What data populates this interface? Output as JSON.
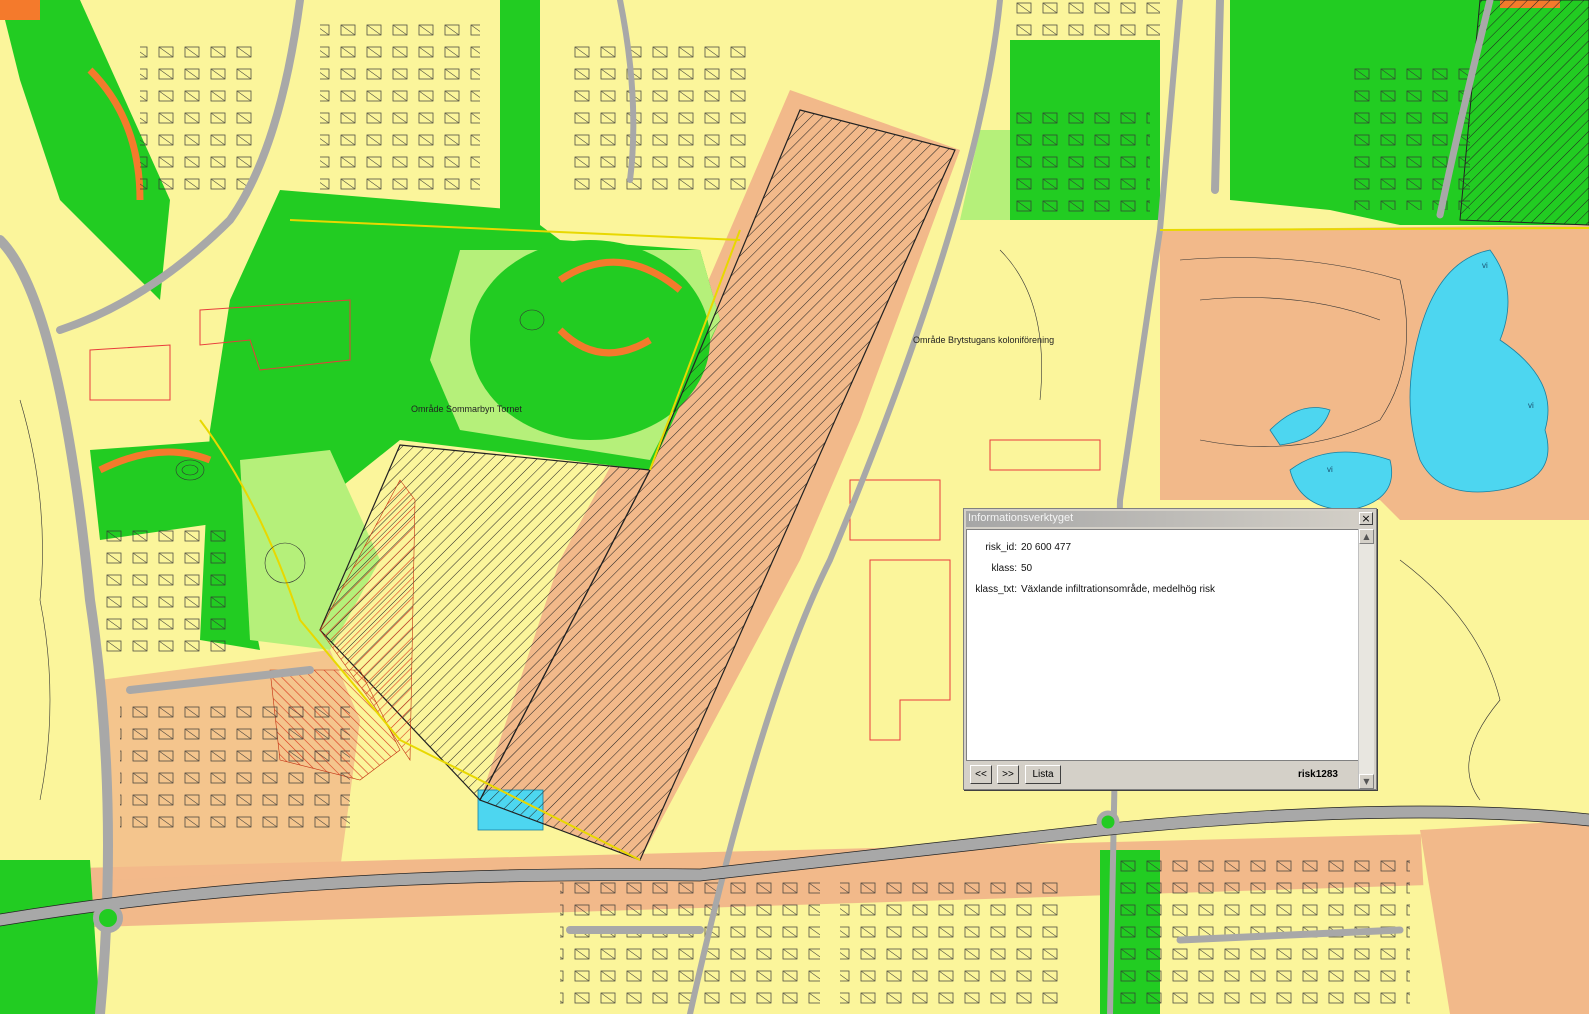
{
  "map": {
    "labels": {
      "sommarbyn": "Område Sommarbyn Tornet",
      "brytstugan": "Område Brytstugans koloniförening"
    },
    "water_labels": [
      "vi",
      "vi",
      "vi"
    ],
    "colors": {
      "base_yellow": "#fbf59b",
      "green": "#22cc22",
      "light_green": "#b5f07a",
      "salmon": "#f2b98a",
      "orange": "#f47a2c",
      "water": "#4dd6f0",
      "road": "#a8a8a8",
      "building_red": "#e83c3c"
    }
  },
  "info_window": {
    "title": "Informationsverktyget",
    "close_symbol": "×",
    "attributes": [
      {
        "key": "risk_id:",
        "value": "20 600 477"
      },
      {
        "key": "klass:",
        "value": "50"
      },
      {
        "key": "klass_txt:",
        "value": "Växlande infiltrationsområde, medelhög risk"
      }
    ],
    "buttons": {
      "prev": "<<",
      "next": ">>",
      "list": "Lista"
    },
    "layer_name": "risk1283"
  }
}
